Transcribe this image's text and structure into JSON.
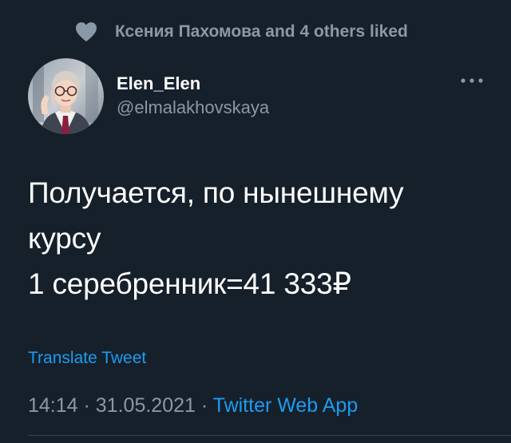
{
  "social_context": {
    "icon": "heart-icon",
    "text": "Ксения Пахомова and 4 others liked"
  },
  "author": {
    "display_name": "Elen_Elen",
    "handle": "@elmalakhovskaya",
    "avatar_icon": "avatar"
  },
  "menu": {
    "icon": "more-icon"
  },
  "tweet": {
    "lines": [
      "Получается, по нынешнему",
      "курсу",
      "1 серебренник=41 333₽"
    ]
  },
  "translate_label": "Translate Tweet",
  "meta": {
    "time": "14:14",
    "separator": " · ",
    "date": "31.05.2021",
    "source": "Twitter Web App"
  },
  "colors": {
    "background": "#15202b",
    "text_primary": "#ffffff",
    "text_secondary": "#8b98a5",
    "accent": "#1d9bf0",
    "divider": "#38444d"
  }
}
